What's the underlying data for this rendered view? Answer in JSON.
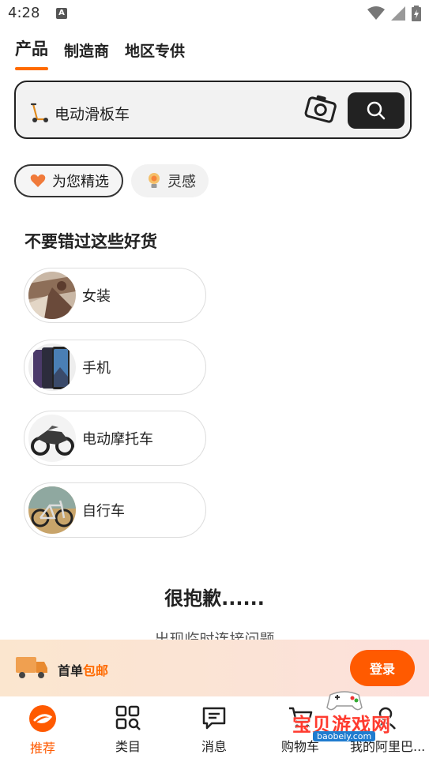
{
  "status_bar": {
    "time": "4:28",
    "notif_letter": "A"
  },
  "tabs": [
    {
      "label": "产品",
      "active": true
    },
    {
      "label": "制造商",
      "active": false
    },
    {
      "label": "地区专供",
      "active": false
    }
  ],
  "search": {
    "query": "电动滑板车",
    "icons": [
      "scooter-icon",
      "camera-icon",
      "search-icon"
    ]
  },
  "chips": [
    {
      "label": "为您精选",
      "icon": "heart-icon"
    },
    {
      "label": "灵感",
      "icon": "lightbulb-icon"
    }
  ],
  "section": {
    "title": "不要错过这些好货",
    "categories": [
      {
        "label": "女装"
      },
      {
        "label": "手机"
      },
      {
        "label": "电动摩托车"
      },
      {
        "label": "自行车"
      }
    ]
  },
  "error": {
    "title": "很抱歉......",
    "subtitle": "出现临时连接问题"
  },
  "promo": {
    "text_prefix": "首单",
    "text_highlight": "包邮",
    "login_label": "登录"
  },
  "nav": [
    {
      "label": "推荐",
      "active": true
    },
    {
      "label": "类目"
    },
    {
      "label": "消息"
    },
    {
      "label": "购物车"
    },
    {
      "label": "我的阿里巴..."
    }
  ],
  "watermark": {
    "text": "宝贝游戏网",
    "url": "baobeiy.com"
  },
  "colors": {
    "accent": "#ff6a00",
    "login_bg": "#ff5a00",
    "dark": "#222222"
  }
}
